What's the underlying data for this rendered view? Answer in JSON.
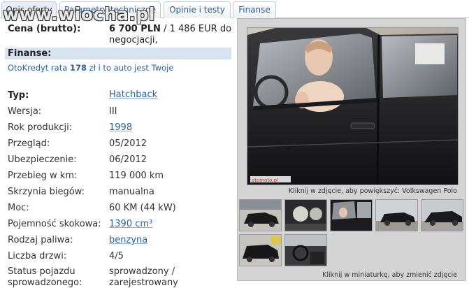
{
  "watermark": "www.wiocha.pl",
  "tabs": [
    "Opis oferty",
    "Parametry techniczne",
    "Opinie i testy",
    "Finanse"
  ],
  "price": {
    "label": "Cena (brutto):",
    "main": "6 700 PLN",
    "rest": " / 1 486 EUR do negocjacji,"
  },
  "finance": {
    "title": "Finanse:",
    "loan_pre": "OtoKredyt rata ",
    "loan_amount": "178",
    "loan_post": " zł i to auto jest Twoje"
  },
  "specs": [
    {
      "label": "Typ:",
      "value": "Hatchback"
    },
    {
      "label": "Wersja:",
      "value": "III"
    },
    {
      "label": "Rok produkcji:",
      "value": "1998"
    },
    {
      "label": "Przegląd:",
      "value": "05/2012"
    },
    {
      "label": "Ubezpieczenie:",
      "value": "06/2012"
    },
    {
      "label": "Przebieg w km:",
      "value": "119 000 km"
    },
    {
      "label": "Skrzynia biegów:",
      "value": "manualna"
    },
    {
      "label": "Moc:",
      "value": "60 KM (44 kW)"
    },
    {
      "label": "Pojemność skokowa:",
      "value": "1390 cm³"
    },
    {
      "label": "Rodzaj paliwa:",
      "value": "benzyna"
    },
    {
      "label": "Liczba drzwi:",
      "value": "4/5"
    },
    {
      "label_line1": "Status pojazdu",
      "label_line2": "sprowadzonego:",
      "value_line1": "sprowadzony /",
      "value_line2": "zarejestrowany"
    }
  ],
  "gallery": {
    "caption_main": "Kliknij w zdjęcie, aby powiększyć: Volkswagen Polo",
    "caption_thumbs": "Kliknij w miniaturkę, aby zmienić zdjęcie",
    "photo_stamp": "otomoto.pl"
  }
}
